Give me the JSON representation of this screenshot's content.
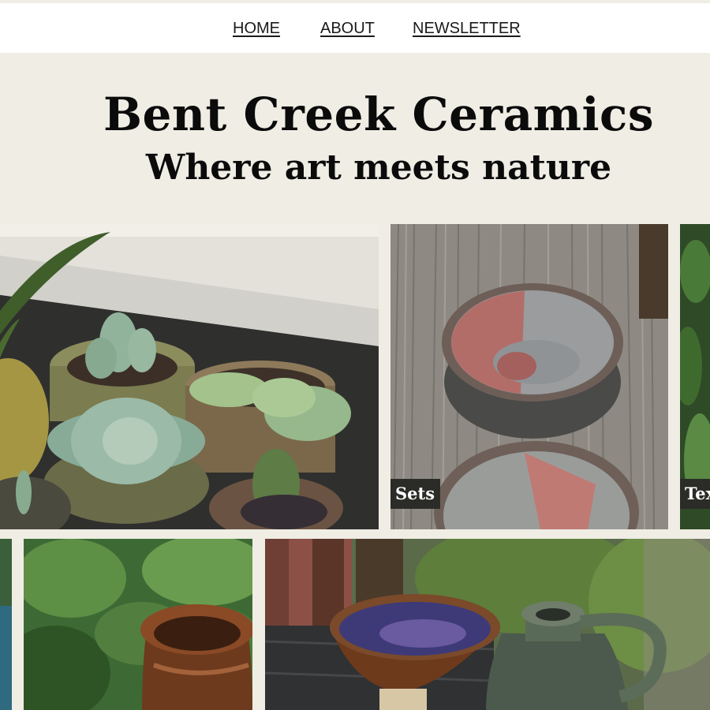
{
  "nav": {
    "home": "HOME",
    "about": "ABOUT",
    "newsletter": "NEWSLETTER"
  },
  "hero": {
    "title": "Bent Creek Ceramics",
    "tagline": "Where art meets nature"
  },
  "gallery": {
    "sets_label": "Sets",
    "third_label": "Tex"
  },
  "colors": {
    "page_background": "#efede4",
    "nav_background": "#ffffff",
    "label_background": "#2b2b28",
    "text": "#0b0b0b"
  }
}
